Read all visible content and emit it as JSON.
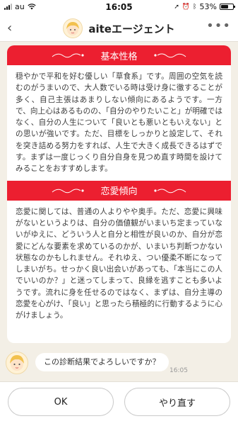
{
  "status_bar": {
    "carrier": "au",
    "time": "16:05",
    "battery": "53%",
    "battery_level": 0.53
  },
  "header": {
    "title": "aiteエージェント",
    "menu_icon": "more-dots-icon"
  },
  "sections": [
    {
      "title": "基本性格",
      "text": "穏やかで平和を好む優しい「草食系」です。周囲の空気を読むのがうまいので、大人数でいる時は受け身に徹することが多く、自己主張はあまりしない傾向にあるようです。一方で、向上心はあるものの、「自分のやりたいこと」が明確ではなく、自分の人生について「良いとも悪いともいえない」との思いが強いです。ただ、目標をしっかりと設定して、それを突き詰める努力をすれば、人生で大きく成長できるはずです。まずは一度じっくり自分自身を見つめ直す時間を設けてみることをおすすめします。"
    },
    {
      "title": "恋愛傾向",
      "text": "恋愛に関しては、普通の人よりやや奥手。ただ、恋愛に興味がないというよりは、自分の価値観がいまいち定まっていないがゆえに、どういう人と自分と相性が良いのか、自分が恋愛にどんな要素を求めているのかが、いまいち判断つかない状態なのかもしれません。それゆえ、つい優柔不断になってしまいがち。せっかく良い出会いがあっても、「本当にこの人でいいのか？」と迷ってしまって、良縁を逃すことも多いようです。流れに身を任せるのではなく、まずは、自分主導の恋愛を心がけ、「良い」と思ったら積極的に行動するように心がけましょう。"
    }
  ],
  "chat": {
    "message": "この診断結果でよろしいですか？",
    "time": "16:05"
  },
  "buttons": {
    "ok": "OK",
    "redo": "やり直す"
  },
  "colors": {
    "accent": "#ec1f30",
    "background": "#f3efe6"
  }
}
